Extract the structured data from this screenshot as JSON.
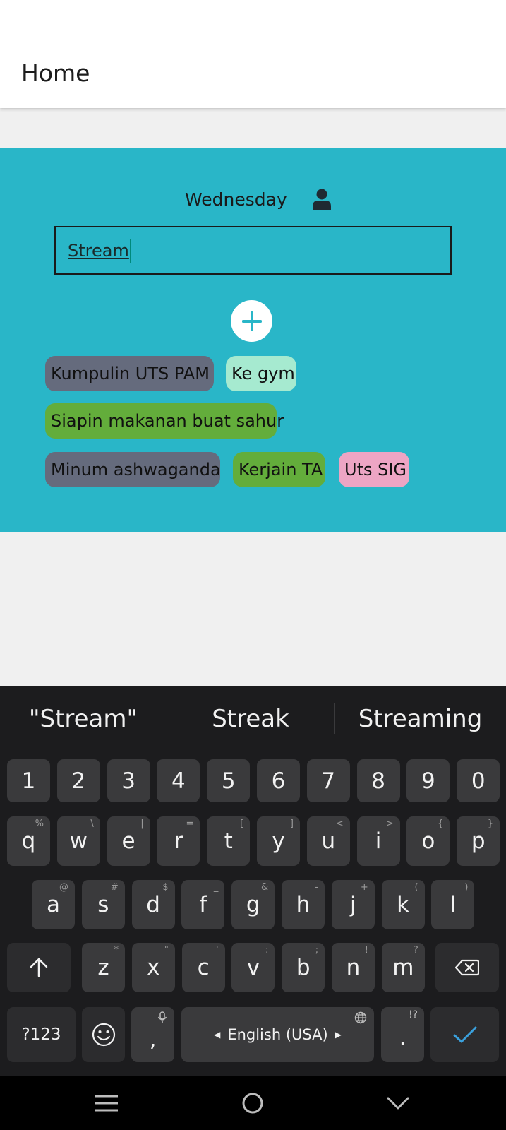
{
  "app_bar": {
    "title": "Home"
  },
  "panel": {
    "day": "Wednesday",
    "input_value": "Stream",
    "background": "#29b6c8",
    "tasks": [
      {
        "label": "Kumpulin UTS PAM",
        "color": "#656b7d"
      },
      {
        "label": "Ke gym",
        "color": "#a6ead0"
      },
      {
        "label": "Siapin makanan buat sahur",
        "color": "#63ad3b"
      },
      {
        "label": "Minum ashwaganda",
        "color": "#656b7d"
      },
      {
        "label": "Kerjain TA",
        "color": "#63ad3b"
      },
      {
        "label": "Uts SIG",
        "color": "#eda5c4"
      }
    ]
  },
  "keyboard": {
    "suggestions": [
      "\"Stream\"",
      "Streak",
      "Streaming"
    ],
    "row_numbers": [
      "1",
      "2",
      "3",
      "4",
      "5",
      "6",
      "7",
      "8",
      "9",
      "0"
    ],
    "row_q": [
      {
        "k": "q",
        "h": "%"
      },
      {
        "k": "w",
        "h": "\\"
      },
      {
        "k": "e",
        "h": "|"
      },
      {
        "k": "r",
        "h": "="
      },
      {
        "k": "t",
        "h": "["
      },
      {
        "k": "y",
        "h": "]"
      },
      {
        "k": "u",
        "h": "<"
      },
      {
        "k": "i",
        "h": ">"
      },
      {
        "k": "o",
        "h": "{"
      },
      {
        "k": "p",
        "h": "}"
      }
    ],
    "row_a": [
      {
        "k": "a",
        "h": "@"
      },
      {
        "k": "s",
        "h": "#"
      },
      {
        "k": "d",
        "h": "$"
      },
      {
        "k": "f",
        "h": "_"
      },
      {
        "k": "g",
        "h": "&"
      },
      {
        "k": "h",
        "h": "-"
      },
      {
        "k": "j",
        "h": "+"
      },
      {
        "k": "k",
        "h": "("
      },
      {
        "k": "l",
        "h": ")"
      }
    ],
    "row_z": [
      {
        "k": "z",
        "h": "*"
      },
      {
        "k": "x",
        "h": "\""
      },
      {
        "k": "c",
        "h": "'"
      },
      {
        "k": "v",
        "h": ":"
      },
      {
        "k": "b",
        "h": ";"
      },
      {
        "k": "n",
        "h": "!"
      },
      {
        "k": "m",
        "h": "?"
      }
    ],
    "sym_key": "?123",
    "comma": ",",
    "space_label": "English (USA)",
    "period": ".",
    "period_hint": "!?",
    "accent": "#3aa0dc"
  }
}
